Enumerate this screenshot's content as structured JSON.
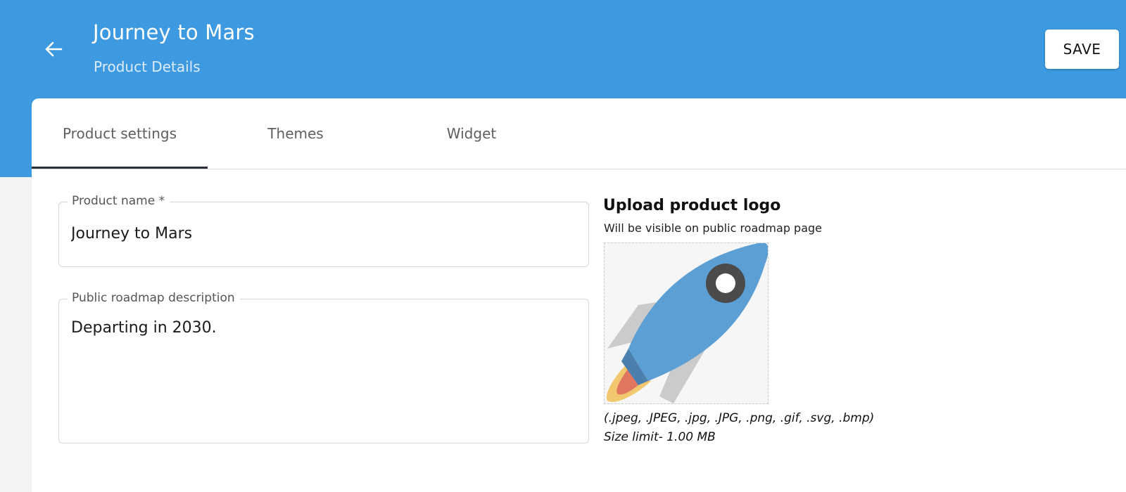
{
  "header": {
    "title": "Journey to Mars",
    "subtitle": "Product Details",
    "save_label": "SAVE",
    "back_icon": "arrow-left-icon",
    "background_color": "#3d9ae0"
  },
  "tabs": [
    {
      "label": "Product settings",
      "active": true
    },
    {
      "label": "Themes",
      "active": false
    },
    {
      "label": "Widget",
      "active": false
    }
  ],
  "form": {
    "product_name": {
      "label": "Product name *",
      "value": "Journey to Mars"
    },
    "description": {
      "label": "Public roadmap description",
      "value": "Departing in 2030."
    }
  },
  "upload": {
    "title": "Upload product logo",
    "subtitle": "Will be visible on public roadmap page",
    "logo_icon": "rocket-icon",
    "formats": "(.jpeg, .JPEG, .jpg, .JPG, .png, .gif, .svg, .bmp)",
    "size_limit": "Size limit- 1.00 MB"
  }
}
